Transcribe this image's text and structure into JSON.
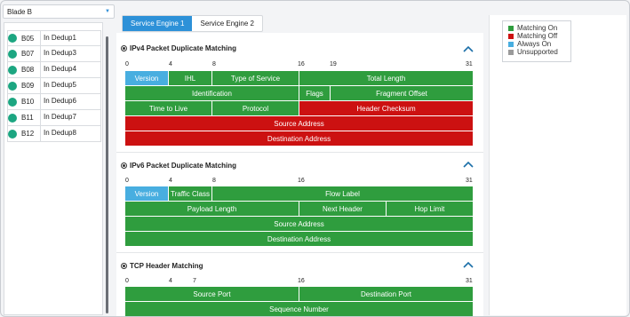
{
  "blade_select": {
    "value": "Blade B"
  },
  "blades": [
    {
      "id": "B05",
      "name": "In Dedup1"
    },
    {
      "id": "B07",
      "name": "In Dedup3"
    },
    {
      "id": "B08",
      "name": "In Dedup4"
    },
    {
      "id": "B09",
      "name": "In Dedup5"
    },
    {
      "id": "B10",
      "name": "In Dedup6"
    },
    {
      "id": "B11",
      "name": "In Dedup7"
    },
    {
      "id": "B12",
      "name": "In Dedup8"
    }
  ],
  "tabs": [
    {
      "label": "Service Engine 1",
      "active": true
    },
    {
      "label": "Service Engine 2",
      "active": false
    }
  ],
  "sections": {
    "ipv4": {
      "title": "IPv4 Packet Duplicate Matching",
      "ruler": [
        "0",
        "4",
        "8",
        "16",
        "19",
        "31"
      ]
    },
    "ipv6": {
      "title": "IPv6 Packet Duplicate Matching",
      "ruler": [
        "0",
        "4",
        "8",
        "16",
        "31"
      ]
    },
    "tcp": {
      "title": "TCP Header Matching",
      "ruler": [
        "0",
        "4",
        "7",
        "16",
        "31"
      ]
    }
  },
  "fields": {
    "ipv4": {
      "version": "Version",
      "ihl": "IHL",
      "tos": "Type of Service",
      "total_length": "Total Length",
      "identification": "Identification",
      "flags": "Flags",
      "fragment_offset": "Fragment Offset",
      "ttl": "Time to Live",
      "protocol": "Protocol",
      "header_checksum": "Header Checksum",
      "source_address": "Source Address",
      "destination_address": "Destination Address"
    },
    "ipv6": {
      "version": "Version",
      "traffic_class": "Traffic Class",
      "flow_label": "Flow Label",
      "payload_length": "Payload Length",
      "next_header": "Next Header",
      "hop_limit": "Hop Limit",
      "source_address": "Source Address",
      "destination_address": "Destination Address"
    },
    "tcp": {
      "source_port": "Source Port",
      "destination_port": "Destination Port",
      "sequence_number": "Sequence Number"
    }
  },
  "legend": {
    "matching_on": "Matching On",
    "matching_off": "Matching Off",
    "always_on": "Always On",
    "unsupported": "Unsupported"
  },
  "colors": {
    "matching_on": "#2f9d3e",
    "matching_off": "#cc1111",
    "always_on": "#48aee0",
    "unsupported": "#9a9a9a",
    "accent": "#2d91d8",
    "status_dot": "#1ca681"
  }
}
